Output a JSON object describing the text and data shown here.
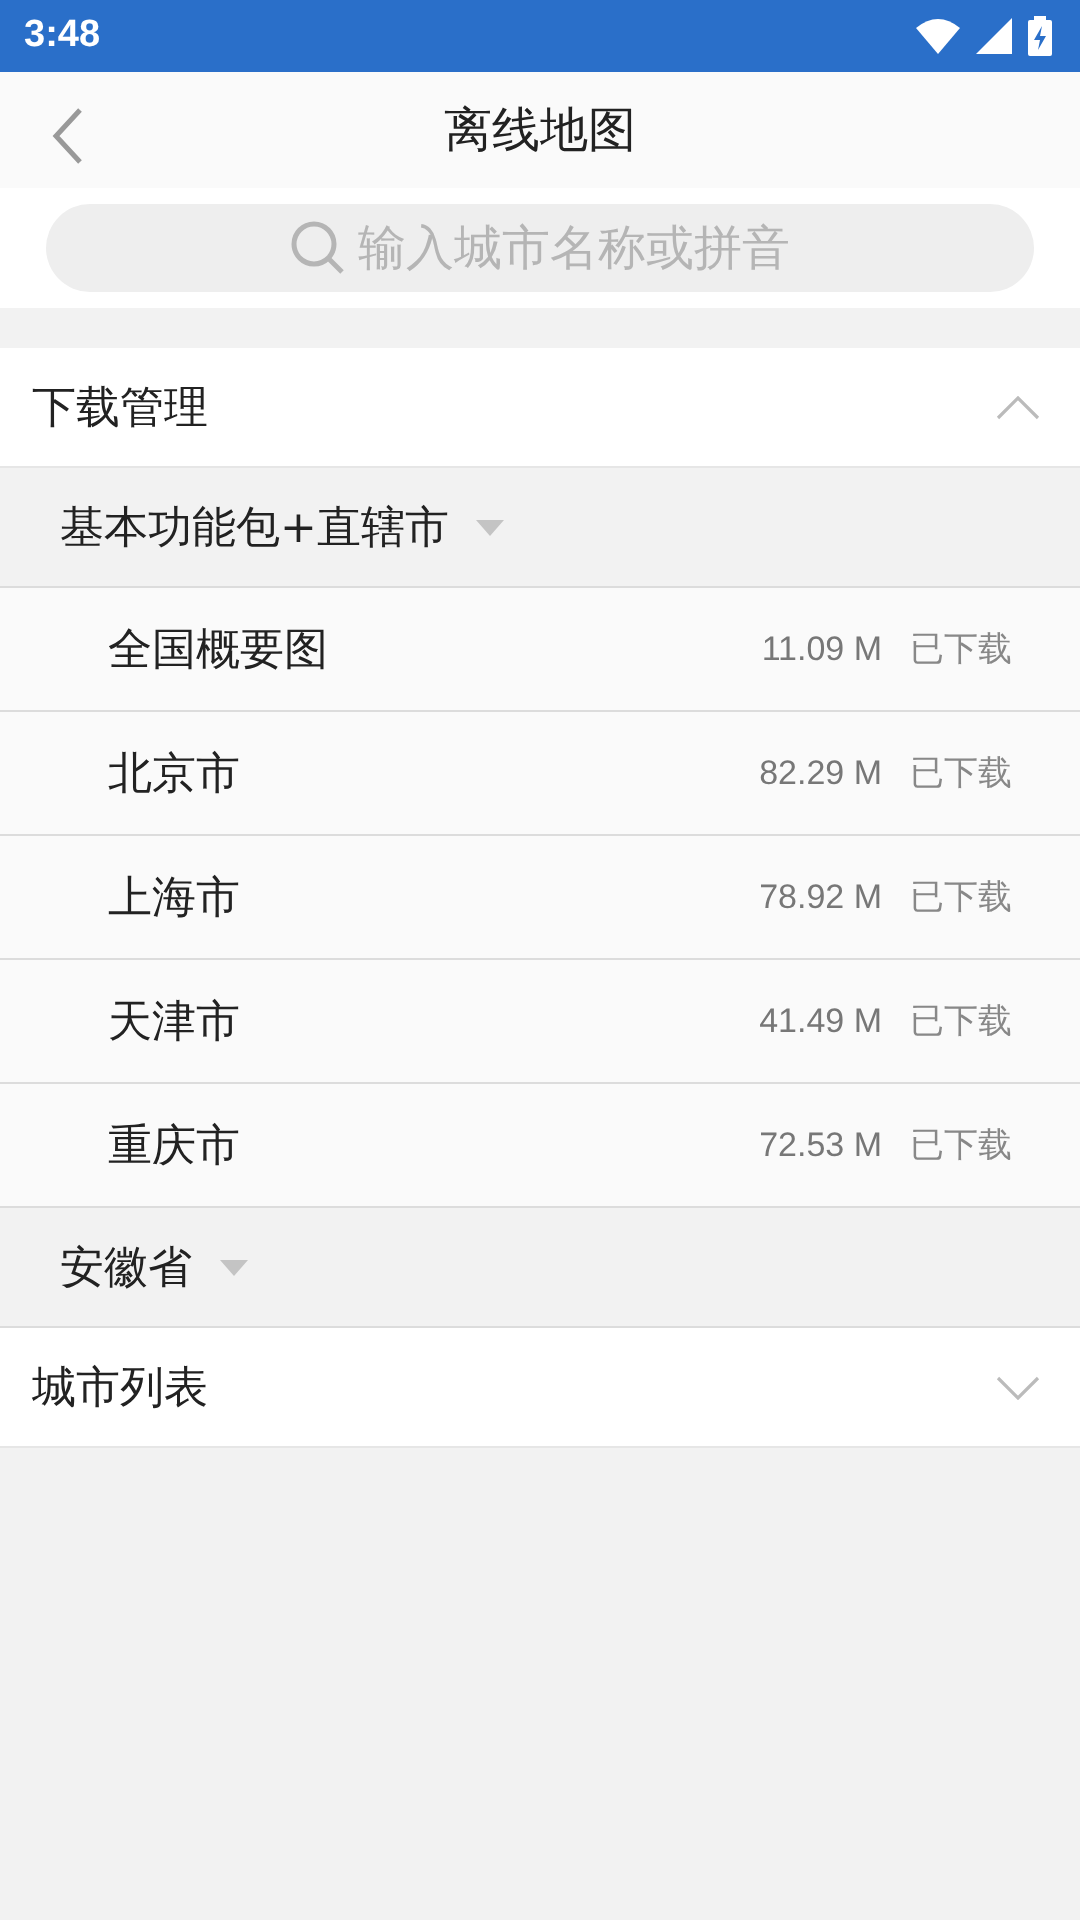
{
  "status_bar": {
    "time": "3:48"
  },
  "header": {
    "title": "离线地图"
  },
  "search": {
    "placeholder": "输入城市名称或拼音"
  },
  "sections": [
    {
      "title": "下载管理",
      "expanded": true,
      "groups": [
        {
          "title": "基本功能包+直辖市",
          "items": [
            {
              "name": "全国概要图",
              "size": "11.09 M",
              "status": "已下载"
            },
            {
              "name": "北京市",
              "size": "82.29 M",
              "status": "已下载"
            },
            {
              "name": "上海市",
              "size": "78.92 M",
              "status": "已下载"
            },
            {
              "name": "天津市",
              "size": "41.49 M",
              "status": "已下载"
            },
            {
              "name": "重庆市",
              "size": "72.53 M",
              "status": "已下载"
            }
          ]
        },
        {
          "title": "安徽省"
        }
      ]
    },
    {
      "title": "城市列表",
      "expanded": false
    }
  ]
}
